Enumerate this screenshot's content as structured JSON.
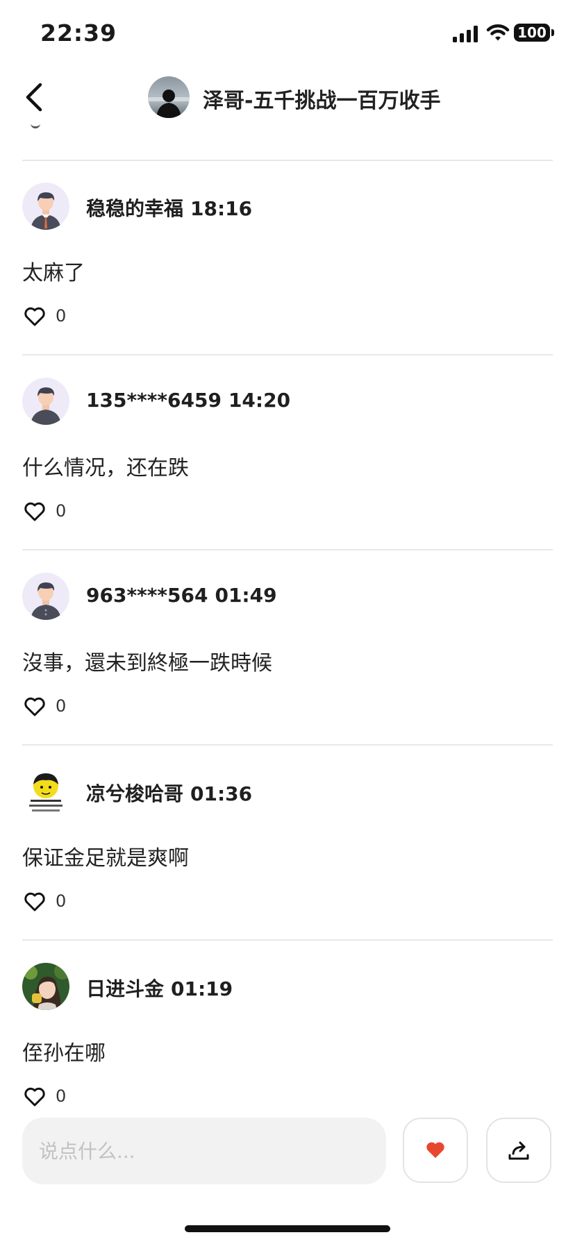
{
  "status_bar": {
    "time": "22:39",
    "battery": "100"
  },
  "header": {
    "title": "泽哥-五千挑战一百万收手"
  },
  "comments": [
    {
      "user": "稳稳的幸福",
      "time": "18:16",
      "text": "太麻了",
      "likes": "0"
    },
    {
      "user": "135****6459",
      "time": "14:20",
      "text": "什么情况，还在跌",
      "likes": "0"
    },
    {
      "user": "963****564",
      "time": "01:49",
      "text": "沒事，還未到終極一跌時候",
      "likes": "0"
    },
    {
      "user": "凉兮梭哈哥",
      "time": "01:36",
      "text": "保证金足就是爽啊",
      "likes": "0"
    },
    {
      "user": "日进斗金",
      "time": "01:19",
      "text": "侄孙在哪",
      "likes": "0"
    }
  ],
  "input": {
    "placeholder": "说点什么..."
  },
  "colors": {
    "like_red": "#e8472f",
    "divider": "#e8e8e8",
    "input_bg": "#f2f2f2"
  },
  "icons": [
    "back-icon",
    "heart-outline-icon",
    "heart-filled-icon",
    "share-icon",
    "signal-icon",
    "wifi-icon"
  ]
}
